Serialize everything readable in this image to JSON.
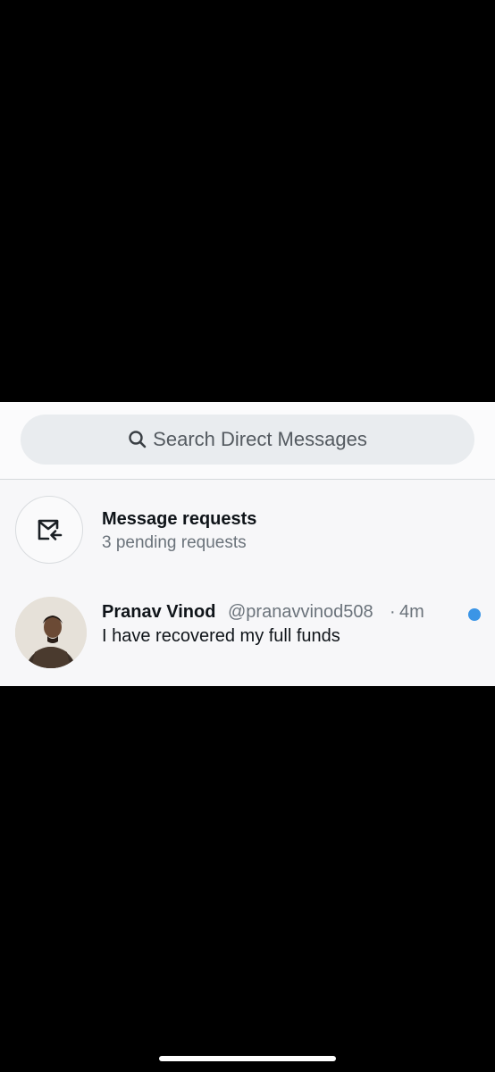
{
  "search": {
    "placeholder": "Search Direct Messages",
    "icon": "search-icon"
  },
  "message_requests": {
    "title": "Message requests",
    "subtitle": "3 pending requests",
    "icon": "mail-request-icon"
  },
  "conversations": [
    {
      "name": "Pranav Vinod",
      "handle": "@pranavvinod508",
      "separator": "·",
      "time": "4m",
      "message": "I have recovered my full funds",
      "unread": true,
      "unread_color": "#3b95e6"
    }
  ],
  "colors": {
    "background": "#000000",
    "panel": "#f7f7f9",
    "search_bar": "#e9ecef",
    "text_primary": "#0f1419",
    "text_secondary": "#6b737b"
  }
}
